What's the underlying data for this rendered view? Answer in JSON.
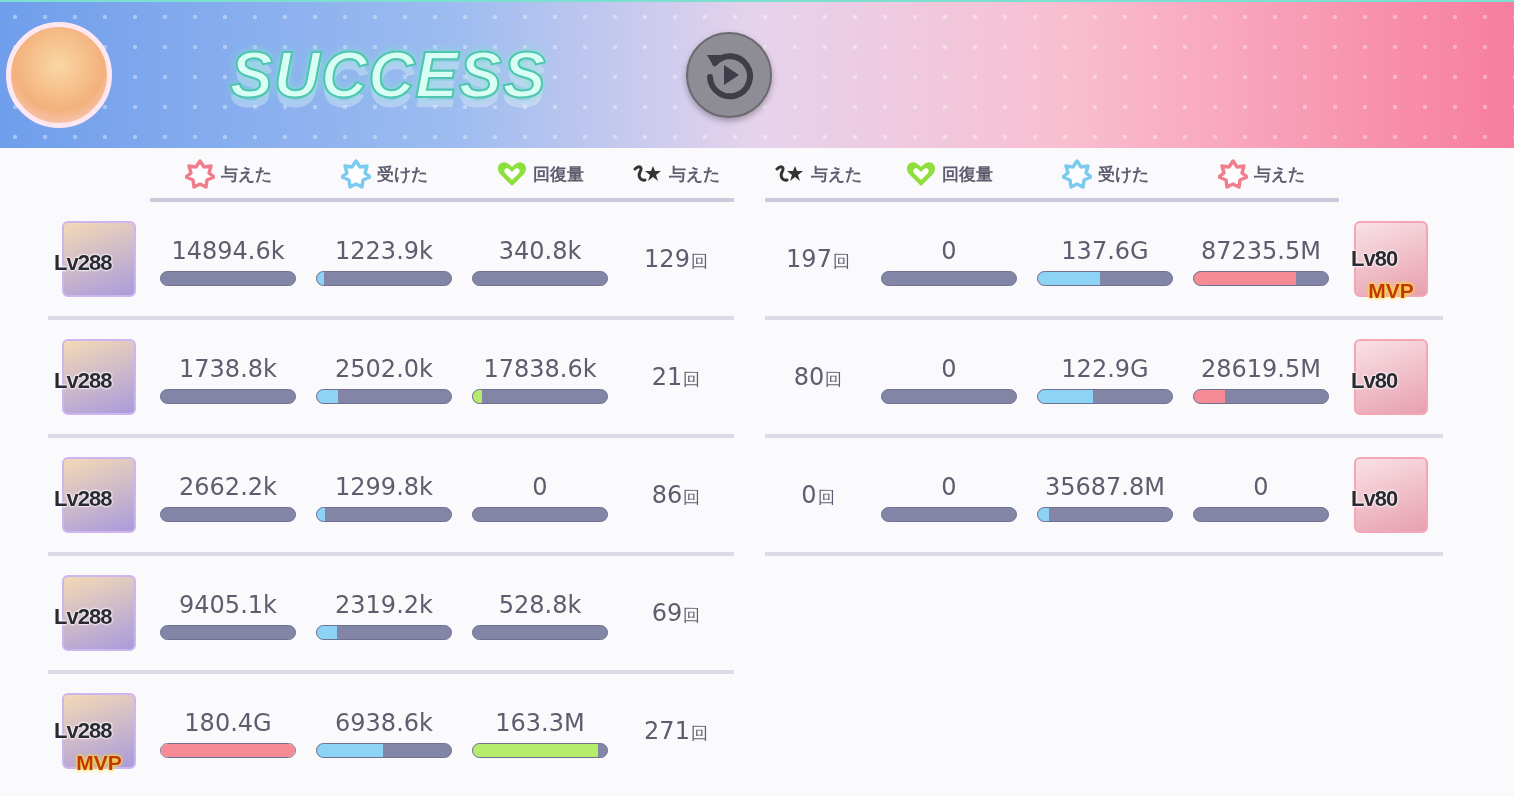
{
  "header": {
    "title": "SUCCESS"
  },
  "panels": [
    {
      "kind": "ally",
      "columns": [
        {
          "kind": "dealt",
          "label": "与えた"
        },
        {
          "kind": "received",
          "label": "受けた"
        },
        {
          "kind": "heal",
          "label": "回復量"
        },
        {
          "kind": "count",
          "label": "与えた"
        }
      ],
      "rows": [
        {
          "level_text": "Lv288",
          "cells": [
            {
              "value": "14894.6k",
              "level": 0
            },
            {
              "value": "1223.9k",
              "level": 0.05
            },
            {
              "value": "340.8k",
              "level": 0
            },
            {
              "value": "129",
              "unit": "回"
            }
          ]
        },
        {
          "level_text": "Lv288",
          "cells": [
            {
              "value": "1738.8k",
              "level": 0
            },
            {
              "value": "2502.0k",
              "level": 0.16
            },
            {
              "value": "17838.6k",
              "level": 0.07
            },
            {
              "value": "21",
              "unit": "回"
            }
          ]
        },
        {
          "level_text": "Lv288",
          "cells": [
            {
              "value": "2662.2k",
              "level": 0
            },
            {
              "value": "1299.8k",
              "level": 0.06
            },
            {
              "value": "0",
              "level": 0
            },
            {
              "value": "86",
              "unit": "回"
            }
          ]
        },
        {
          "level_text": "Lv288",
          "cells": [
            {
              "value": "9405.1k",
              "level": 0
            },
            {
              "value": "2319.2k",
              "level": 0.15
            },
            {
              "value": "528.8k",
              "level": 0
            },
            {
              "value": "69",
              "unit": "回"
            }
          ]
        },
        {
          "level_text": "Lv288",
          "badge": "MVP",
          "cells": [
            {
              "value": "180.4G",
              "level": 1
            },
            {
              "value": "6938.6k",
              "level": 0.49
            },
            {
              "value": "163.3M",
              "level": 0.93
            },
            {
              "value": "271",
              "unit": "回"
            }
          ]
        }
      ]
    },
    {
      "kind": "enemy",
      "columns": [
        {
          "kind": "count",
          "label": "与えた"
        },
        {
          "kind": "heal",
          "label": "回復量"
        },
        {
          "kind": "received",
          "label": "受けた"
        },
        {
          "kind": "dealt",
          "label": "与えた"
        }
      ],
      "rows": [
        {
          "level_text": "Lv80",
          "badge": "MVP",
          "cells": [
            {
              "value": "197",
              "unit": "回"
            },
            {
              "value": "0",
              "level": 0
            },
            {
              "value": "137.6G",
              "level": 0.46
            },
            {
              "value": "87235.5M",
              "level": 0.76
            }
          ]
        },
        {
          "level_text": "Lv80",
          "cells": [
            {
              "value": "80",
              "unit": "回"
            },
            {
              "value": "0",
              "level": 0
            },
            {
              "value": "122.9G",
              "level": 0.41
            },
            {
              "value": "28619.5M",
              "level": 0.23
            }
          ]
        },
        {
          "level_text": "Lv80",
          "cells": [
            {
              "value": "0",
              "unit": "回"
            },
            {
              "value": "0",
              "level": 0
            },
            {
              "value": "35687.8M",
              "level": 0.08
            },
            {
              "value": "0",
              "level": 0
            }
          ]
        }
      ]
    }
  ]
}
